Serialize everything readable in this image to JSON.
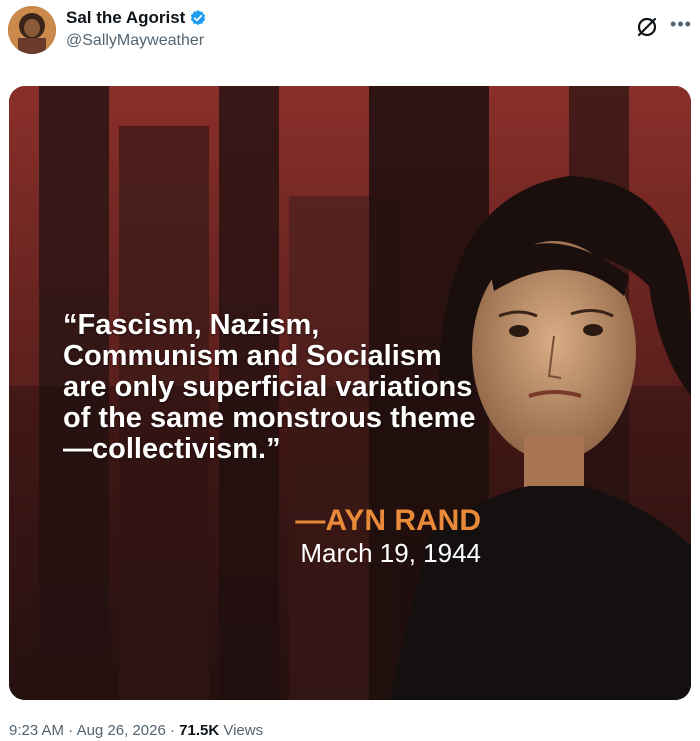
{
  "author": {
    "display_name": "Sal the Agorist",
    "handle": "@SallyMayweather",
    "verified": true
  },
  "icons": {
    "verified": "verified-badge-icon",
    "grok": "grok-icon",
    "more": "more-icon"
  },
  "image": {
    "quote_text": "“Fascism, Nazism, Communism and Socialism are only superficial variations of the same monstrous theme—collectivism.”",
    "attribution": "—AYN RAND",
    "date": "March 19, 1944"
  },
  "meta": {
    "time": "9:23 AM",
    "date": "Aug 26, 2026",
    "views_count": "71.5K",
    "views_label": "Views",
    "separator": "·"
  },
  "colors": {
    "accent_blue": "#1d9bf0",
    "attribution_orange": "#e88a3a",
    "background_red": "#6b2320"
  }
}
